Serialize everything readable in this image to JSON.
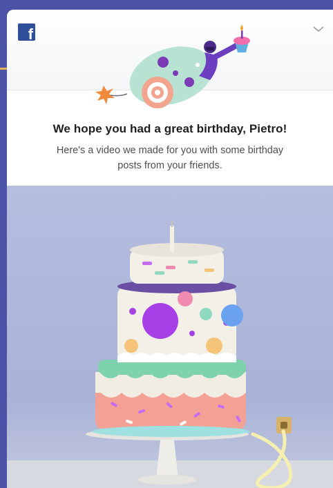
{
  "app": {
    "logo_letter": "f"
  },
  "notification": {
    "title": "We hope you had a great birthday, Pietro!",
    "body": "Here's a video we made for you with some birthday posts from your friends."
  },
  "icons": {
    "logo": "facebook-logo-icon",
    "menu": "chevron-down-icon"
  },
  "colors": {
    "frame": "#4b53a6",
    "brand": "#2f4f9b",
    "title_text": "#1c1e21",
    "body_text": "#4b4f56"
  }
}
